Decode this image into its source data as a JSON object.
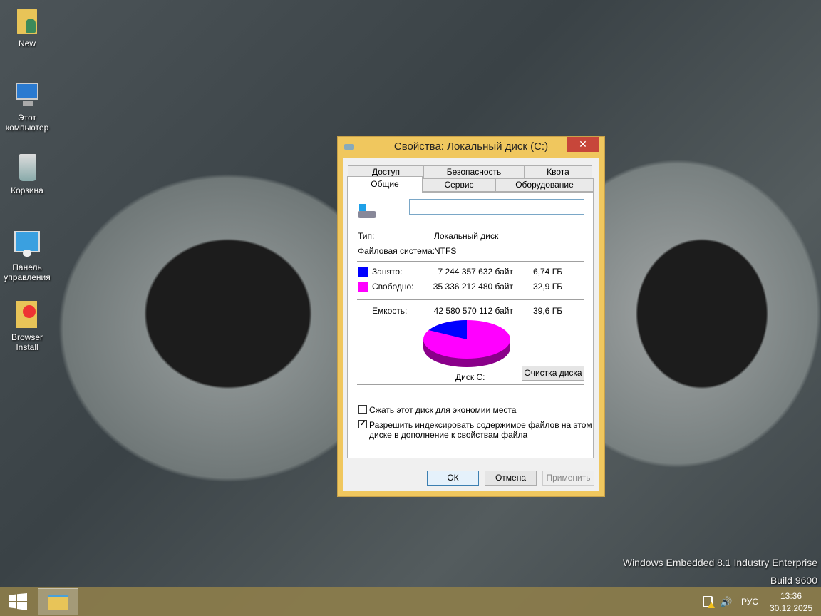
{
  "desktop": {
    "icons": [
      {
        "label": "New"
      },
      {
        "label": "Этот компьютер"
      },
      {
        "label": "Корзина"
      },
      {
        "label": "Панель управления"
      },
      {
        "label": "Browser Install"
      }
    ],
    "watermark": {
      "line1": "Windows Embedded 8.1 Industry Enterprise",
      "line2": "Build 9600"
    }
  },
  "dialog": {
    "title": "Свойства: Локальный диск (C:)",
    "close": "✕",
    "tabs_back": [
      "Доступ",
      "Безопасность",
      "Квота"
    ],
    "tabs_front": [
      "Общие",
      "Сервис",
      "Оборудование"
    ],
    "name_value": "",
    "type_label": "Тип:",
    "type_value": "Локальный диск",
    "fs_label": "Файловая система:",
    "fs_value": "NTFS",
    "used": {
      "label": "Занято:",
      "bytes": "7 244 357 632 байт",
      "size": "6,74 ГБ",
      "color": "#0000ff"
    },
    "free": {
      "label": "Свободно:",
      "bytes": "35 336 212 480 байт",
      "size": "32,9 ГБ",
      "color": "#ff00ff"
    },
    "capacity": {
      "label": "Емкость:",
      "bytes": "42 580 570 112 байт",
      "size": "39,6 ГБ"
    },
    "used_fraction": 0.17,
    "drive_label": "Диск C:",
    "cleanup": "Очистка диска",
    "compress": {
      "label": "Сжать этот диск для экономии места",
      "checked": false
    },
    "index": {
      "line1": "Разрешить индексировать содержимое файлов на этом",
      "line2": "диске в дополнение к свойствам файла",
      "checked": true,
      "mark": "✔"
    },
    "ok": "ОК",
    "cancel": "Отмена",
    "apply": "Применить"
  },
  "taskbar": {
    "lang": "РУС",
    "time": "13:36",
    "date": "30.12.2025"
  }
}
